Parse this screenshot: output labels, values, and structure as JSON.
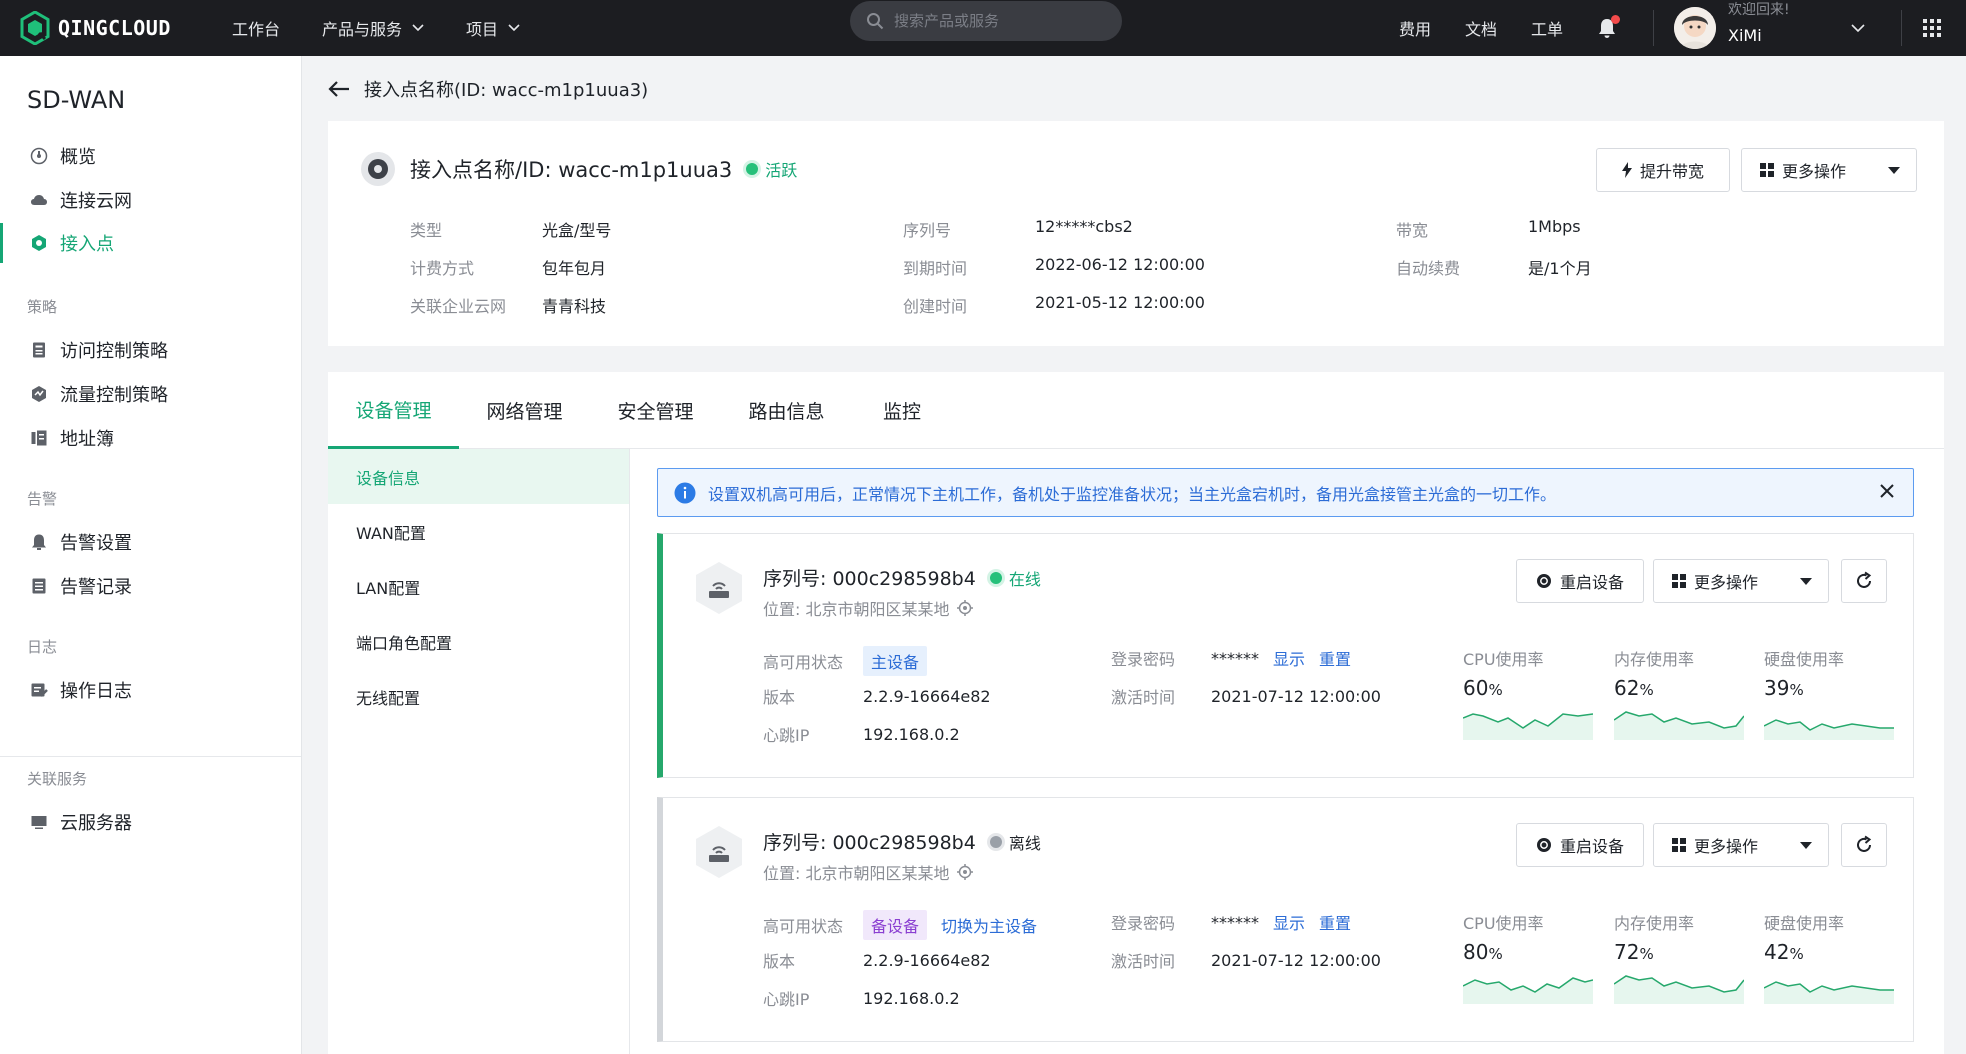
{
  "topbar": {
    "logo": "QINGCLOUD",
    "nav": [
      "工作台",
      "产品与服务",
      "项目"
    ],
    "search_placeholder": "搜索产品或服务",
    "links": [
      "费用",
      "文档",
      "工单"
    ],
    "welcome": "欢迎回来!",
    "username": "XiMi"
  },
  "sidebar": {
    "title": "SD-WAN",
    "items_main": [
      "概览",
      "连接云网",
      "接入点"
    ],
    "group_policy": "策略",
    "items_policy": [
      "访问控制策略",
      "流量控制策略",
      "地址簿"
    ],
    "group_alert": "告警",
    "items_alert": [
      "告警设置",
      "告警记录"
    ],
    "group_log": "日志",
    "items_log": [
      "操作日志"
    ],
    "group_related": "关联服务",
    "items_related": [
      "云服务器"
    ]
  },
  "page": {
    "back_title": "接入点名称(ID: wacc-m1p1uua3)",
    "title": "接入点名称/ID: wacc-m1p1uua3",
    "status": "活跃",
    "btn_upgrade": "提升带宽",
    "btn_more": "更多操作",
    "info": {
      "type_k": "类型",
      "type_v": "光盒/型号",
      "billing_k": "计费方式",
      "billing_v": "包年包月",
      "company_k": "关联企业云网",
      "company_v": "青青科技",
      "serial_k": "序列号",
      "serial_v": "12*****cbs2",
      "expire_k": "到期时间",
      "expire_v": "2022-06-12 12:00:00",
      "created_k": "创建时间",
      "created_v": "2021-05-12 12:00:00",
      "bw_k": "带宽",
      "bw_v": "1Mbps",
      "renew_k": "自动续费",
      "renew_v": "是/1个月"
    }
  },
  "tabs": [
    "设备管理",
    "网络管理",
    "安全管理",
    "路由信息",
    "监控"
  ],
  "subnav": [
    "设备信息",
    "WAN配置",
    "LAN配置",
    "端口角色配置",
    "无线配置"
  ],
  "notice": "设置双机高可用后，正常情况下主机工作，备机处于监控准备状况；当主光盒宕机时，备用光盒接管主光盒的一切工作。",
  "device_labels": {
    "ha_k": "高可用状态",
    "ver_k": "版本",
    "hb_k": "心跳IP",
    "pwd_k": "登录密码",
    "act_k": "激活时间",
    "show": "显示",
    "reset": "重置",
    "reboot": "重启设备",
    "more": "更多操作",
    "switch_primary": "切换为主设备",
    "cpu": "CPU使用率",
    "mem": "内存使用率",
    "disk": "硬盘使用率",
    "pct": "%"
  },
  "devices": [
    {
      "serial": "序列号: 000c298598b4",
      "status": "在线",
      "location": "位置: 北京市朝阳区某某地",
      "ha": "主设备",
      "version": "2.2.9-16664e82",
      "heartbeat": "192.168.0.2",
      "password": "******",
      "activated": "2021-07-12 12:00:00",
      "cpu": "60",
      "mem": "62",
      "disk": "39"
    },
    {
      "serial": "序列号: 000c298598b4",
      "status": "离线",
      "location": "位置: 北京市朝阳区某某地",
      "ha": "备设备",
      "version": "2.2.9-16664e82",
      "heartbeat": "192.168.0.2",
      "password": "******",
      "activated": "2021-07-12 12:00:00",
      "cpu": "80",
      "mem": "72",
      "disk": "42"
    }
  ],
  "colors": {
    "brand": "#15a675",
    "link": "#2c6cd6",
    "topbar": "#1c1d21"
  }
}
